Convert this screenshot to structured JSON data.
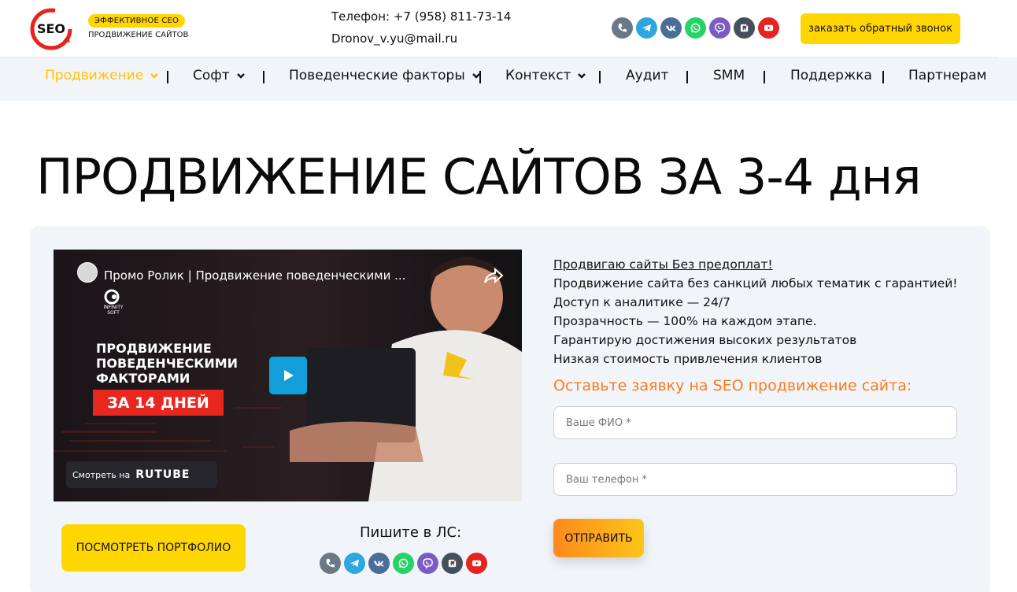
{
  "header": {
    "tagline_badge": "ЭФФЕКТИВНОЕ СЕО",
    "tagline_sub": "ПРОДВИЖЕНИЕ САЙТОВ",
    "phone": "Телефон: +7 (958) 811-73-14",
    "email": "Dronov_v.yu@mail.ru",
    "callback_label": "заказать обратный звонок",
    "logo_text": "SEO"
  },
  "socials": [
    {
      "icon": "phone-icon",
      "color": "#6b7886"
    },
    {
      "icon": "telegram-icon",
      "color": "#2ea6e0"
    },
    {
      "icon": "vk-icon",
      "color": "#4a6e99"
    },
    {
      "icon": "whatsapp-icon",
      "color": "#25d366"
    },
    {
      "icon": "viber-icon",
      "color": "#7b5cc4"
    },
    {
      "icon": "rutube-icon",
      "color": "#44505c"
    },
    {
      "icon": "youtube-icon",
      "color": "#e52420"
    }
  ],
  "nav": {
    "items": [
      {
        "label": "Продвижение",
        "dropdown": true,
        "active": true
      },
      {
        "label": "Софт",
        "dropdown": true
      },
      {
        "label": "Поведенческие факторы",
        "dropdown": true
      },
      {
        "label": "Контекст",
        "dropdown": true
      },
      {
        "label": "Аудит"
      },
      {
        "label": "SMM"
      },
      {
        "label": "Поддержка"
      },
      {
        "label": "Партнерам"
      }
    ]
  },
  "hero": {
    "title": "ПРОДВИЖЕНИЕ САЙТОВ ЗА 3-4 дня"
  },
  "video": {
    "title": "Промо Ролик | Продвижение поведенческими ...",
    "brand_line1": "INFINITY",
    "brand_line2": "SOFT",
    "headline_1": "ПРОДВИЖЕНИЕ",
    "headline_2": "ПОВЕДЕНЧЕСКИМИ",
    "headline_3": "ФАКТОРАМИ",
    "badge": "ЗА 14 ДНЕЙ",
    "watch_on": "Смотреть на",
    "watch_brand": "RUTUBE"
  },
  "left_actions": {
    "portfolio_label": "ПОСМОТРЕТЬ ПОРТФОЛИО",
    "dm_label": "Пишите в ЛС:"
  },
  "benefits": [
    "Продвигаю сайты Без предоплат!",
    "Продвижение сайта без санкций любых тематик с гарантией!",
    "Доступ к аналитике — 24/7",
    "Прозрачность — 100% на каждом этапе.",
    "Гарантирую достижения высоких результатов",
    "Низкая стоимость привлечения клиентов"
  ],
  "form": {
    "title": "Оставьте заявку на SEO продвижение сайта:",
    "name_placeholder": "Ваше ФИО *",
    "phone_placeholder": "Ваш телефон *",
    "submit_label": "ОТПРАВИТЬ"
  },
  "colors": {
    "accent": "#ffd600",
    "nav_bg": "#f1f5fa",
    "form_title": "#ff7a1a",
    "logo_red": "#e52420"
  }
}
